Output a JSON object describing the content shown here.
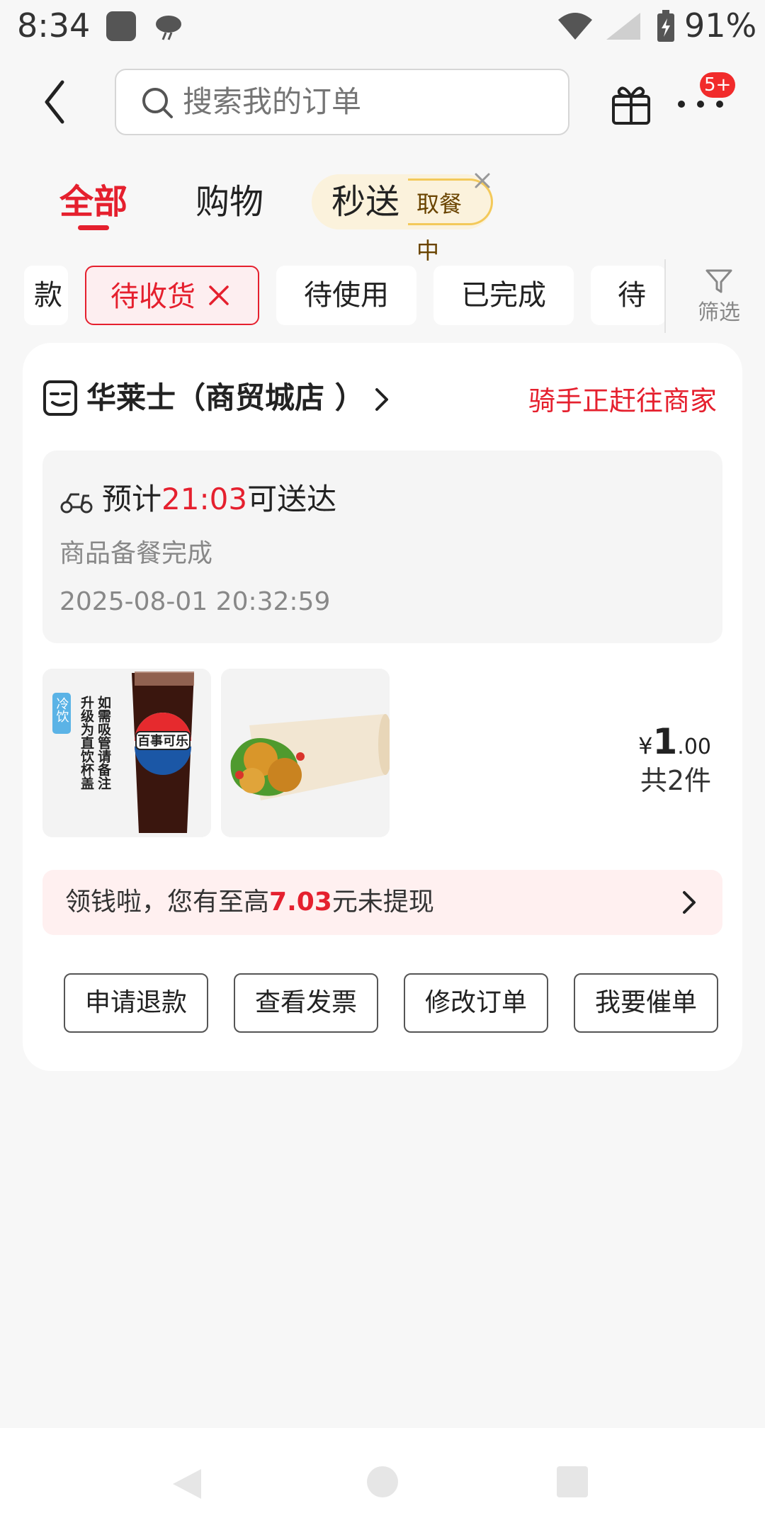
{
  "status_bar": {
    "time": "8:34",
    "battery_pct": "91%"
  },
  "search": {
    "placeholder": "搜索我的订单"
  },
  "header": {
    "more_badge": "5+"
  },
  "tabs": {
    "all": "全部",
    "shopping": "购物",
    "flash": "秒送",
    "flash_tag": "取餐中"
  },
  "filters": {
    "partial_left": "款",
    "active": "待收货",
    "to_use": "待使用",
    "done": "已完成",
    "partial_right": "待评",
    "filter_label": "筛选"
  },
  "order": {
    "store_name": "华莱士（商贸城店 ）",
    "status": "骑手正赶往商家",
    "eta_prefix": "预计",
    "eta_time": "21:03",
    "eta_suffix": "可送达",
    "prep_status": "商品备餐完成",
    "timestamp": "2025-08-01 20:32:59",
    "price_symbol": "¥",
    "price_int": "1",
    "price_dec": ".00",
    "item_count": "共2件",
    "drink_brand": "百事可乐",
    "drink_tag": "冷饮",
    "drink_note_1": "如需吸管请备注",
    "drink_note_2": "升级为直饮杯盖"
  },
  "promo": {
    "prefix": "领钱啦，您有至高",
    "amount": "7.03",
    "suffix": "元未提现"
  },
  "actions": {
    "refund": "申请退款",
    "invoice": "查看发票",
    "modify": "修改订单",
    "urge": "我要催单"
  },
  "colors": {
    "accent": "#e5202e",
    "flash_bg": "#fbf2dc",
    "promo_bg": "#fff0f0"
  }
}
